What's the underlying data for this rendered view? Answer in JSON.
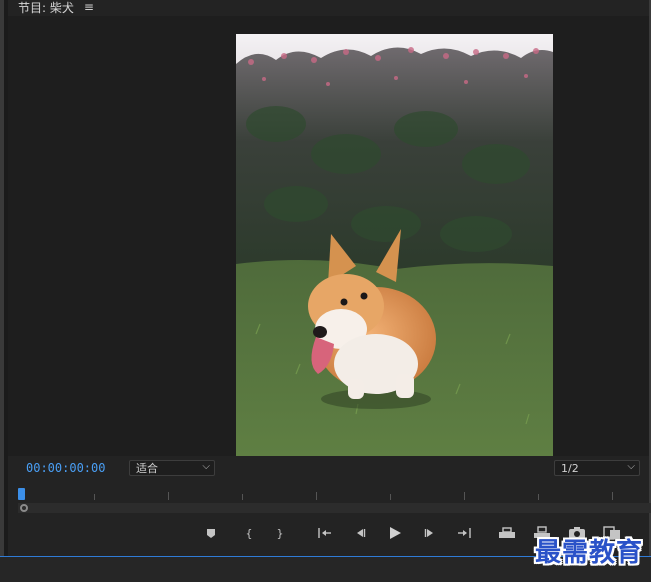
{
  "panel": {
    "title": "节目: 柴犬",
    "menu_icon": "hamburger-menu-icon"
  },
  "playback": {
    "timecode": "00:00:00:00",
    "fit_select": {
      "value": "适合",
      "icon": "chevron-down-icon"
    },
    "resolution_select": {
      "value": "1/2",
      "icon": "chevron-down-icon"
    }
  },
  "video": {
    "description_icon": "corgi-photo"
  },
  "controls": [
    {
      "name": "add-marker-button",
      "icon": "marker-icon"
    },
    {
      "name": "mark-in-button",
      "icon": "mark-in-icon"
    },
    {
      "name": "mark-out-button",
      "icon": "mark-out-icon"
    },
    {
      "name": "go-to-in-button",
      "icon": "go-to-in-icon"
    },
    {
      "name": "step-back-button",
      "icon": "step-back-icon"
    },
    {
      "name": "play-button",
      "icon": "play-icon"
    },
    {
      "name": "step-forward-button",
      "icon": "step-forward-icon"
    },
    {
      "name": "go-to-out-button",
      "icon": "go-to-out-icon"
    },
    {
      "name": "lift-button",
      "icon": "lift-icon"
    },
    {
      "name": "extract-button",
      "icon": "extract-icon"
    },
    {
      "name": "export-frame-button",
      "icon": "camera-icon"
    },
    {
      "name": "comparison-view-button",
      "icon": "comparison-icon"
    }
  ],
  "watermark": {
    "text": "最需教育"
  }
}
